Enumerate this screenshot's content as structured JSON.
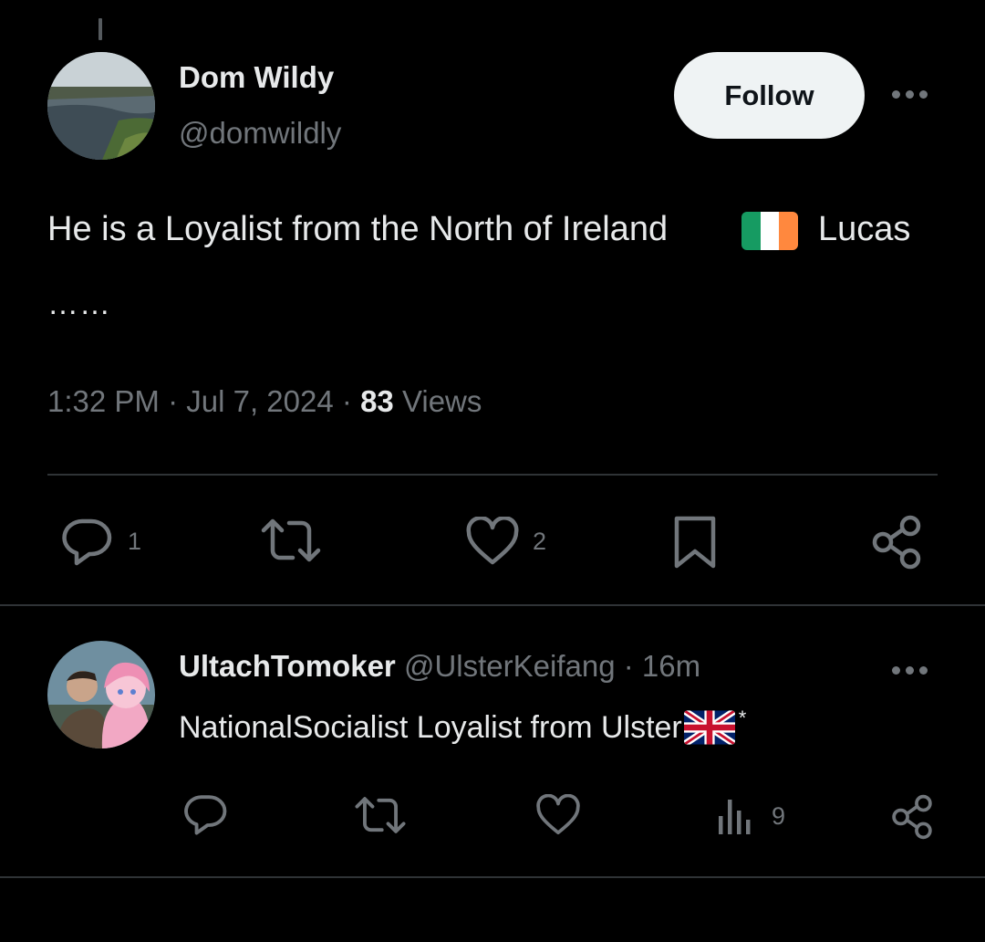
{
  "tweet": {
    "author_name": "Dom Wildy",
    "author_handle": "@domwildly",
    "follow_label": "Follow",
    "text": "He is a Loyalist from the North of Ireland",
    "text_after_flag": "Lucas",
    "text_line2": "……",
    "time": "1:32 PM",
    "date": "Jul 7, 2024",
    "views_count": "83",
    "views_label": "Views",
    "separator": "·",
    "actions": {
      "reply_count": "1",
      "like_count": "2"
    },
    "icons": [
      "reply-icon",
      "retweet-icon",
      "like-icon",
      "bookmark-icon",
      "share-icon",
      "more-icon"
    ]
  },
  "reply": {
    "author_name": "UltachTomoker",
    "author_handle": "@UlsterKeifang",
    "separator": "·",
    "time_ago": "16m",
    "text": "NationalSocialist Loyalist from Ulster",
    "suffix": "*",
    "actions": {
      "views_count": "9"
    },
    "icons": [
      "reply-icon",
      "retweet-icon",
      "like-icon",
      "views-icon",
      "share-icon",
      "more-icon"
    ]
  },
  "colors": {
    "background": "#000000",
    "primary_text": "#e7e9ea",
    "secondary_text": "#71767b",
    "divider": "#2f3336",
    "follow_bg": "#eff3f4",
    "irish_green": "#169b62",
    "irish_white": "#ffffff",
    "irish_orange": "#ff883e"
  }
}
